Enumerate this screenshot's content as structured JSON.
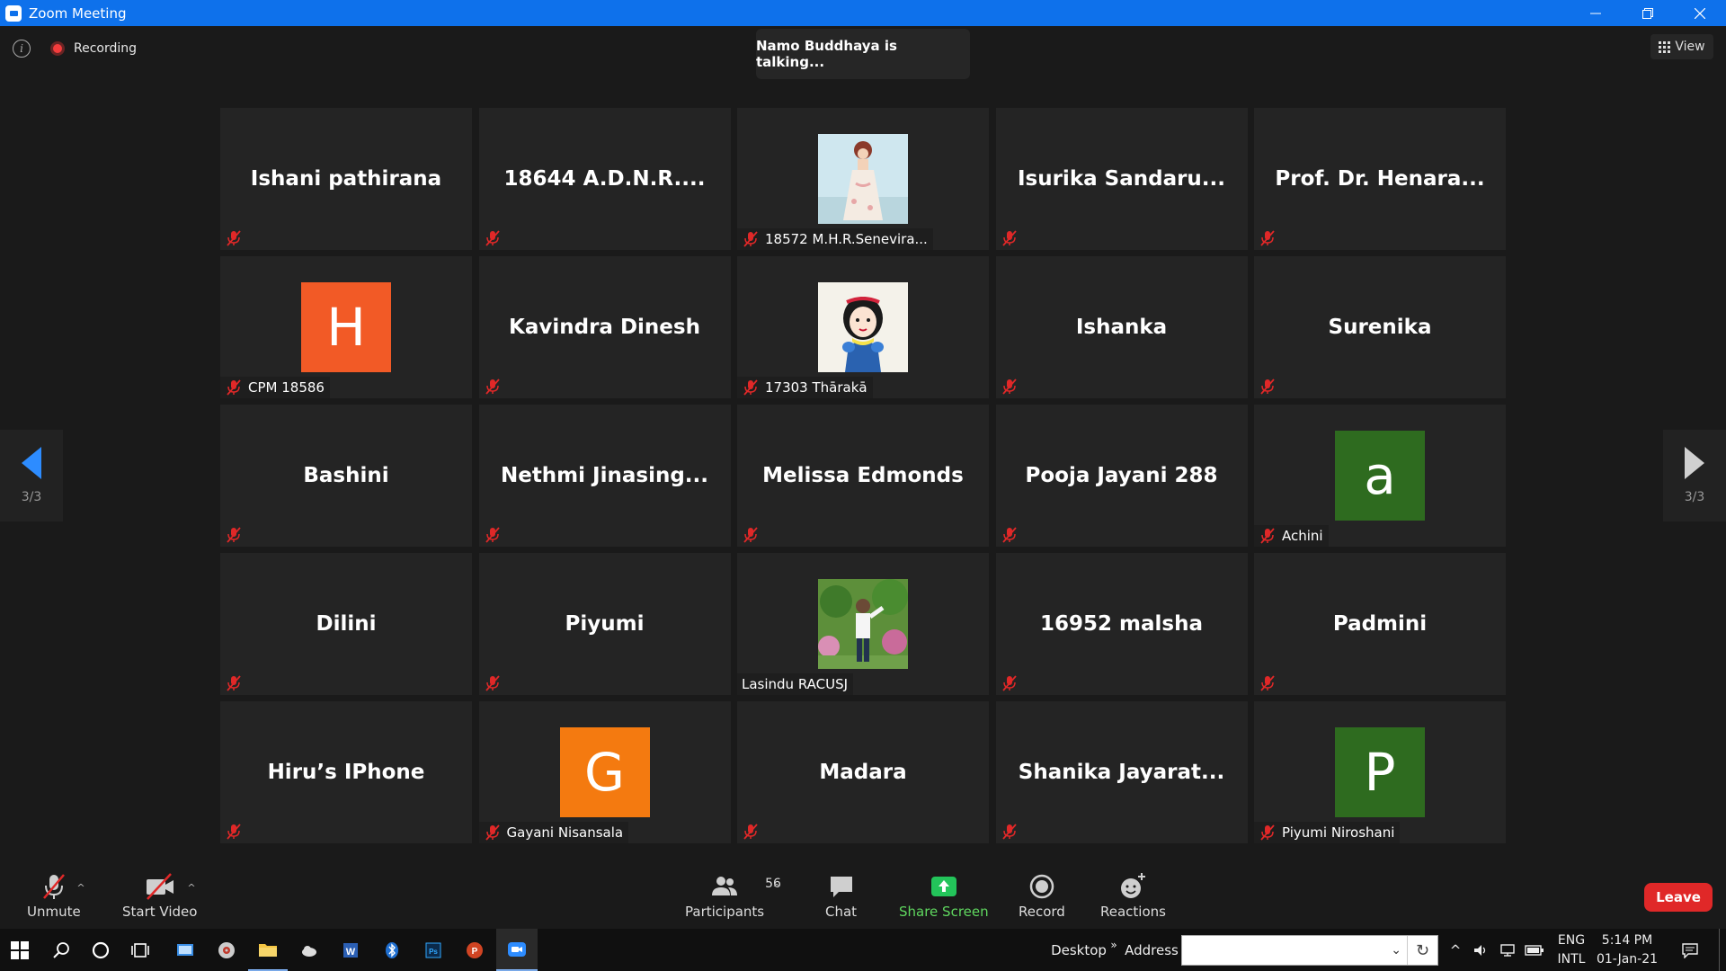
{
  "window": {
    "title": "Zoom Meeting"
  },
  "top_bar": {
    "recording_label": "Recording",
    "talking_text": "Namo Buddhaya is talking...",
    "view_label": "View"
  },
  "pagination": {
    "left_page": "3/3",
    "right_page": "3/3"
  },
  "participants": [
    {
      "name": "Ishani pathirana",
      "kind": "name"
    },
    {
      "name": "18644  A.D.N.R....",
      "kind": "name"
    },
    {
      "name": "18572 M.H.R.Senevira...",
      "kind": "photo",
      "photo": "princess-photo"
    },
    {
      "name": "Isurika  Sandaru...",
      "kind": "name"
    },
    {
      "name": "Prof. Dr. Henara...",
      "kind": "name"
    },
    {
      "name": "CPM 18586",
      "kind": "avatar",
      "letter": "H",
      "color": "#f25a26"
    },
    {
      "name": "Kavindra Dinesh",
      "kind": "name"
    },
    {
      "name": "17303 Thārakā",
      "kind": "photo",
      "photo": "snow-white-photo"
    },
    {
      "name": "Ishanka",
      "kind": "name"
    },
    {
      "name": "Surenika",
      "kind": "name"
    },
    {
      "name": "Bashini",
      "kind": "name"
    },
    {
      "name": "Nethmi  Jinasing...",
      "kind": "name"
    },
    {
      "name": "Melissa Edmonds",
      "kind": "name"
    },
    {
      "name": "Pooja Jayani 288",
      "kind": "name"
    },
    {
      "name": "Achini",
      "kind": "avatar",
      "letter": "a",
      "color": "#2e6b1f"
    },
    {
      "name": "Dilini",
      "kind": "name"
    },
    {
      "name": "Piyumi",
      "kind": "name"
    },
    {
      "name": "Lasindu RACUSJ",
      "kind": "photo",
      "photo": "man-outdoor-photo",
      "unmuted": true
    },
    {
      "name": "16952 malsha",
      "kind": "name"
    },
    {
      "name": "Padmini",
      "kind": "name"
    },
    {
      "name": "Hiru’s IPhone",
      "kind": "name"
    },
    {
      "name": "Gayani Nisansala",
      "kind": "avatar",
      "letter": "G",
      "color": "#f47a10"
    },
    {
      "name": "Madara",
      "kind": "name"
    },
    {
      "name": "Shanika  Jayarat...",
      "kind": "name"
    },
    {
      "name": "Piyumi Niroshani",
      "kind": "avatar",
      "letter": "P",
      "color": "#2e6b1f"
    }
  ],
  "toolbar": {
    "unmute_label": "Unmute",
    "start_video_label": "Start Video",
    "participants_label": "Participants",
    "participants_count": "56",
    "chat_label": "Chat",
    "share_screen_label": "Share Screen",
    "record_label": "Record",
    "reactions_label": "Reactions",
    "leave_label": "Leave"
  },
  "taskbar": {
    "desktop_label": "Desktop",
    "address_label": "Address",
    "lang_line1": "ENG",
    "lang_line2": "INTL",
    "time": "5:14 PM",
    "date": "01-Jan-21"
  },
  "colors": {
    "titlebar": "#0e71eb",
    "tile_bg": "#242424",
    "mute_red": "#e02828",
    "leave_red": "#e02828",
    "share_green": "#23c45a"
  }
}
